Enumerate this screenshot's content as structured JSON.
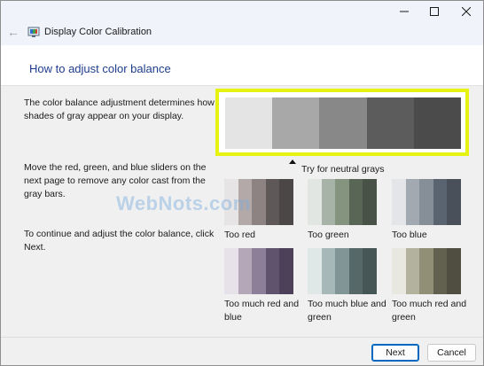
{
  "window": {
    "title": "Display Color Calibration",
    "back_icon": "arrow-left",
    "app_icon": "color-calibration-icon"
  },
  "page": {
    "heading": "How to adjust color balance",
    "para1": "The color balance adjustment determines how shades of gray appear on your display.",
    "para2": "Move the red, green, and blue sliders on the next page to remove any color cast from the gray bars.",
    "para3": "To continue and adjust the color balance, click Next.",
    "caption": "Try for neutral grays"
  },
  "gray_bars": {
    "highlight_color": "#e6f312",
    "shades": [
      "#e4e4e4",
      "#a8a8a8",
      "#888888",
      "#5c5c5c",
      "#4b4b4b"
    ]
  },
  "swatches": [
    {
      "label": "Too red",
      "colors": [
        "#e6e4e4",
        "#b4a9a9",
        "#8e8383",
        "#5e5858",
        "#4b4747"
      ]
    },
    {
      "label": "Too green",
      "colors": [
        "#e2e6e2",
        "#a7b3a6",
        "#84947f",
        "#596656",
        "#495246"
      ]
    },
    {
      "label": "Too blue",
      "colors": [
        "#e3e5e8",
        "#a3a9b1",
        "#868e98",
        "#5a6370",
        "#4a505a"
      ]
    },
    {
      "label": "Too much red and blue",
      "colors": [
        "#e7e2ea",
        "#b3a7b8",
        "#8e7f98",
        "#5f536d",
        "#4d4159"
      ]
    },
    {
      "label": "Too much blue and green",
      "colors": [
        "#e0e8e7",
        "#a7b8b8",
        "#819596",
        "#566868",
        "#465556"
      ]
    },
    {
      "label": "Too much red and green",
      "colors": [
        "#e8e8e0",
        "#b3b29f",
        "#919077",
        "#626150",
        "#4f4e40"
      ]
    }
  ],
  "watermark": "WebNots.com",
  "buttons": {
    "next": "Next",
    "cancel": "Cancel"
  }
}
